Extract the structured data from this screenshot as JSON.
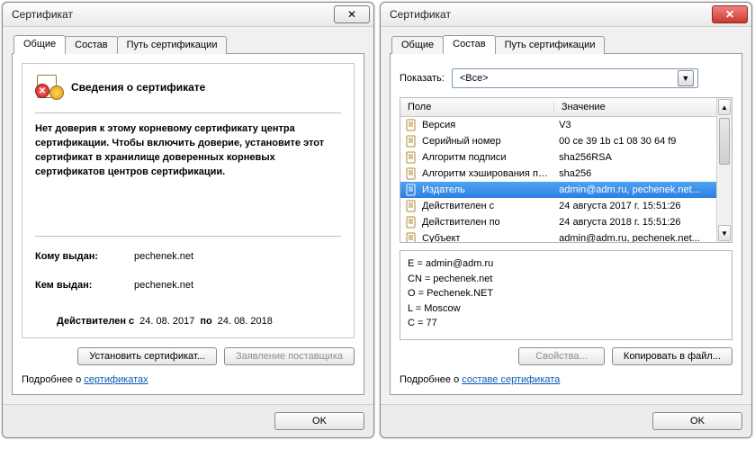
{
  "left": {
    "title": "Сертификат",
    "tabs": [
      "Общие",
      "Состав",
      "Путь сертификации"
    ],
    "active_tab": 0,
    "header": "Сведения о сертификате",
    "warning": "Нет доверия к этому корневому сертификату центра сертификации. Чтобы включить  доверие, установите этот сертификат в хранилище доверенных корневых сертификатов центров сертификации.",
    "issued_to_label": "Кому выдан:",
    "issued_to_value": "pechenek.net",
    "issued_by_label": "Кем выдан:",
    "issued_by_value": "pechenek.net",
    "valid_from_label": "Действителен с",
    "valid_from_value": "24. 08. 2017",
    "valid_to_label": "по",
    "valid_to_value": "24. 08. 2018",
    "install_btn": "Установить сертификат...",
    "issuer_stmt_btn": "Заявление поставщика",
    "more_prefix": "Подробнее о ",
    "more_link": "сертификатах",
    "ok": "OK"
  },
  "right": {
    "title": "Сертификат",
    "tabs": [
      "Общие",
      "Состав",
      "Путь сертификации"
    ],
    "active_tab": 1,
    "show_label": "Показать:",
    "show_value": "<Все>",
    "col_field": "Поле",
    "col_value": "Значение",
    "rows": [
      {
        "field": "Версия",
        "value": "V3"
      },
      {
        "field": "Серийный номер",
        "value": "00 ce 39 1b c1 08 30 64 f9"
      },
      {
        "field": "Алгоритм подписи",
        "value": "sha256RSA"
      },
      {
        "field": "Алгоритм хэширования по...",
        "value": "sha256"
      },
      {
        "field": "Издатель",
        "value": "admin@adm.ru, pechenek.net..."
      },
      {
        "field": "Действителен с",
        "value": "24 августа 2017 г. 15:51:26"
      },
      {
        "field": "Действителен по",
        "value": "24 августа 2018 г. 15:51:26"
      },
      {
        "field": "Субъект",
        "value": "admin@adm.ru, pechenek.net..."
      }
    ],
    "selected_row": 4,
    "details": [
      "E = admin@adm.ru",
      "CN = pechenek.net",
      "O = Pechenek.NET",
      "L = Moscow",
      "C = 77"
    ],
    "props_btn": "Свойства...",
    "copyfile_btn": "Копировать в файл...",
    "more_prefix": "Подробнее о ",
    "more_link": "составе сертификата",
    "ok": "OK"
  }
}
